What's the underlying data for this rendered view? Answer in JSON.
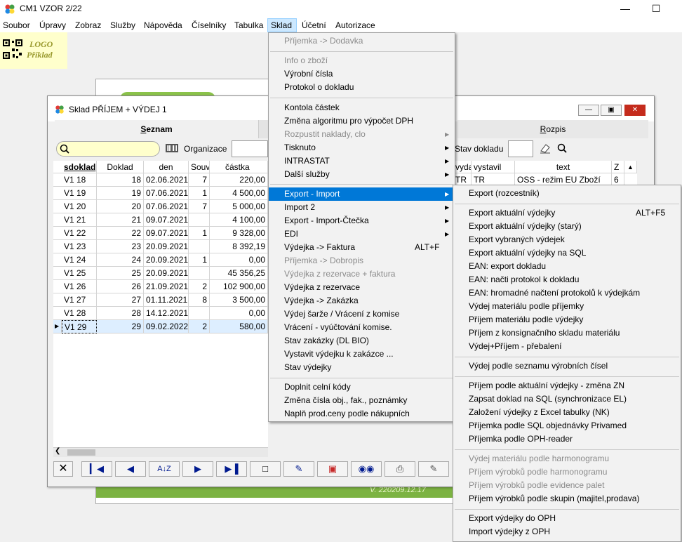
{
  "window": {
    "title": "CM1 VZOR 2/22"
  },
  "menubar": [
    "Soubor",
    "Úpravy",
    "Zobraz",
    "Služby",
    "Nápověda",
    "Číselníky",
    "Tabulka",
    "Sklad",
    "Účetní",
    "Autorizace"
  ],
  "logo": {
    "line1": "LOGO",
    "line2": "Příklad"
  },
  "background": {
    "version": "V. 220209.12.17"
  },
  "child": {
    "title": "Sklad PŘÍJEM + VÝDEJ 1",
    "tab_seznam": "Seznam",
    "tab_seznam_u": "S",
    "tab_seznam_rest": "eznam",
    "tab_rozpis_u": "R",
    "tab_rozpis_rest": "ozpis",
    "org_label": "Organizace",
    "stav_label": "Stav dokladu",
    "grid_headers": [
      "sdoklad",
      "Doklad",
      "den",
      "Souv.",
      "částka"
    ],
    "rows": [
      [
        "V1  18",
        "18",
        "02.06.2021",
        "7",
        "220,00"
      ],
      [
        "V1  19",
        "19",
        "07.06.2021",
        "1",
        "4 500,00"
      ],
      [
        "V1  20",
        "20",
        "07.06.2021",
        "7",
        "5 000,00"
      ],
      [
        "V1  21",
        "21",
        "09.07.2021",
        "",
        "4 100,00"
      ],
      [
        "V1  22",
        "22",
        "09.07.2021",
        "1",
        "9 328,00"
      ],
      [
        "V1  23",
        "23",
        "20.09.2021",
        "",
        "8 392,19"
      ],
      [
        "V1  24",
        "24",
        "20.09.2021",
        "1",
        "0,00"
      ],
      [
        "V1  25",
        "25",
        "20.09.2021",
        "",
        "45 356,25"
      ],
      [
        "V1  26",
        "26",
        "21.09.2021",
        "2",
        "102 900,00"
      ],
      [
        "V1  27",
        "27",
        "01.11.2021",
        "8",
        "3 500,00"
      ],
      [
        "V1  28",
        "28",
        "14.12.2021",
        "",
        "0,00"
      ],
      [
        "V1  29",
        "29",
        "09.02.2022",
        "2",
        "580,00"
      ]
    ],
    "rozpis_headers": [
      "vydal",
      "vystavil",
      "text",
      "Z"
    ],
    "rozpis_row": [
      "TR",
      "TR",
      "OSS - režim EU Zboží",
      "6"
    ]
  },
  "sklad_menu": [
    {
      "label": "Příjemka -> Dodavka",
      "dis": true
    },
    {
      "sep": true
    },
    {
      "label": "Info o zboží",
      "dis": true
    },
    {
      "label": "Výrobní čísla"
    },
    {
      "label": "Protokol o dokladu"
    },
    {
      "sep": true
    },
    {
      "label": "Kontola částek"
    },
    {
      "label": "Změna algoritmu pro výpočet DPH"
    },
    {
      "label": "Rozpustit naklady, clo",
      "dis": true,
      "sub": true
    },
    {
      "label": "Tisknuto",
      "sub": true
    },
    {
      "label": "INTRASTAT",
      "sub": true
    },
    {
      "label": "Další služby",
      "sub": true
    },
    {
      "sep": true
    },
    {
      "label": "Export - Import",
      "sub": true,
      "hi": true
    },
    {
      "label": "Import 2",
      "sub": true
    },
    {
      "label": "Export - Import-Čtečka",
      "sub": true
    },
    {
      "label": "EDI",
      "sub": true
    },
    {
      "label": "Výdejka -> Faktura",
      "sc": "ALT+F"
    },
    {
      "label": "Příjemka -> Dobropis",
      "dis": true
    },
    {
      "label": "Výdejka z rezervace + faktura",
      "dis": true
    },
    {
      "label": "Výdejka z rezervace"
    },
    {
      "label": "Výdejka -> Zakázka"
    },
    {
      "label": "Výdej šarže / Vrácení z komise"
    },
    {
      "label": "Vrácení - vyúčtování komise."
    },
    {
      "label": "Stav zakázky (DL BIO)"
    },
    {
      "label": "Vystavit výdejku k zakázce ..."
    },
    {
      "label": "Stav výdejky"
    },
    {
      "sep": true
    },
    {
      "label": "Doplnit celní kódy"
    },
    {
      "label": "Změna čísla obj., fak., poznámky"
    },
    {
      "label": "Naplň prod.ceny podle nákupních"
    }
  ],
  "export_menu": [
    {
      "label": "Export (rozcestník)"
    },
    {
      "sep": true
    },
    {
      "label": "Export aktuální výdejky",
      "sc": "ALT+F5"
    },
    {
      "label": "Export aktuální výdejky (starý)"
    },
    {
      "label": "Export vybraných výdejek"
    },
    {
      "label": "Export aktuální výdejky na SQL"
    },
    {
      "label": "EAN: export dokladu"
    },
    {
      "label": "EAN: načti protokol k dokladu"
    },
    {
      "label": "EAN: hromadné načtení protokolů k výdejkám"
    },
    {
      "label": "Výdej materiálu podle příjemky"
    },
    {
      "label": "Příjem materiálu podle výdejky"
    },
    {
      "label": "Příjem z konsignačního skladu materiálu"
    },
    {
      "label": "Výdej+Příjem - přebalení"
    },
    {
      "sep": true
    },
    {
      "label": "Výdej podle seznamu výrobních čísel"
    },
    {
      "sep": true
    },
    {
      "label": "Příjem podle aktuální výdejky - změna ZN"
    },
    {
      "label": "Zapsat doklad na SQL (synchronizace EL)"
    },
    {
      "label": "Založení výdejky z Excel tabulky (NK)"
    },
    {
      "label": "Příjemka podle SQL objednávky Privamed"
    },
    {
      "label": "Příjemka podle OPH-reader"
    },
    {
      "sep": true
    },
    {
      "label": "Výdej materiálu podle harmonogramu",
      "dis": true
    },
    {
      "label": "Příjem výrobků podle harmonogramu",
      "dis": true
    },
    {
      "label": "Příjem výrobků podle evidence palet",
      "dis": true
    },
    {
      "label": "Příjem výrobků podle skupin (majitel,prodava)"
    },
    {
      "sep": true
    },
    {
      "label": "Export výdejky do OPH"
    },
    {
      "label": "Import výdejky z OPH"
    }
  ],
  "icons": [
    "app-icon",
    "qr-icon",
    "search-icon",
    "barcode-icon",
    "first-icon",
    "prev-icon",
    "sort-icon",
    "next-icon",
    "last-icon",
    "new-doc-icon",
    "edit-icon",
    "delete-icon",
    "binoculars-icon",
    "print-icon",
    "eraser-icon",
    "close-x-icon"
  ]
}
